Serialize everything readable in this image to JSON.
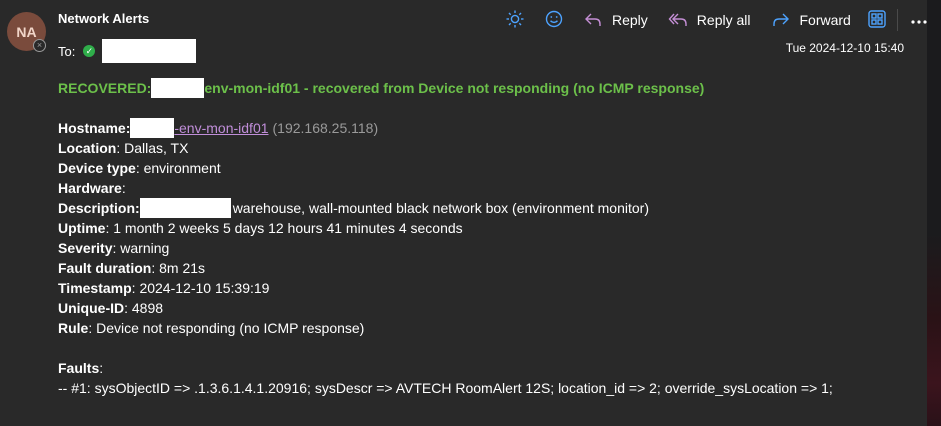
{
  "sender": {
    "initials": "NA",
    "name": "Network Alerts"
  },
  "to_label": "To:",
  "toolbar": {
    "reply_label": "Reply",
    "reply_all_label": "Reply all",
    "forward_label": "Forward",
    "more_label": "…"
  },
  "timestamp": "Tue 2024-12-10 15:40",
  "subject": {
    "prefix": "RECOVERED:",
    "rest": "env-mon-idf01 - recovered from Device not responding (no ICMP response)"
  },
  "fields": {
    "hostname_label": "Hostname",
    "hostname_link": "-env-mon-idf01",
    "hostname_ip": "(192.168.25.118)",
    "location_label": "Location",
    "location_value": ": Dallas, TX",
    "device_type_label": "Device type",
    "device_type_value": ": environment",
    "hardware_label": "Hardware",
    "hardware_value": ":",
    "description_label": "Description",
    "description_value": "warehouse, wall-mounted black network box (environment monitor)",
    "uptime_label": "Uptime",
    "uptime_value": ": 1 month 2 weeks 5 days 12 hours 41 minutes 4 seconds",
    "severity_label": "Severity",
    "severity_value": ": warning",
    "fault_duration_label": "Fault duration",
    "fault_duration_value": ": 8m 21s",
    "timestamp_label": "Timestamp",
    "timestamp_value": ": 2024-12-10 15:39:19",
    "unique_id_label": "Unique-ID",
    "unique_id_value": ": 4898",
    "rule_label": "Rule",
    "rule_value": ": Device not responding (no ICMP response)"
  },
  "faults": {
    "label": "Faults",
    "colon": ":",
    "item_1": "-- #1: sysObjectID => .1.3.6.1.4.1.20916; sysDescr => AVTECH RoomAlert 12S; location_id => 2; override_sysLocation => 1;"
  },
  "colors": {
    "background": "#292929",
    "subject_green": "#6cc04a",
    "accent_blue": "#4da3ff",
    "link_purple": "#c08ed9",
    "reply_purple": "#c58fd6"
  },
  "icons": [
    "brightness-icon",
    "emoji-icon",
    "reply-icon",
    "reply-all-icon",
    "forward-icon",
    "immersive-reader-icon",
    "more-icon"
  ]
}
